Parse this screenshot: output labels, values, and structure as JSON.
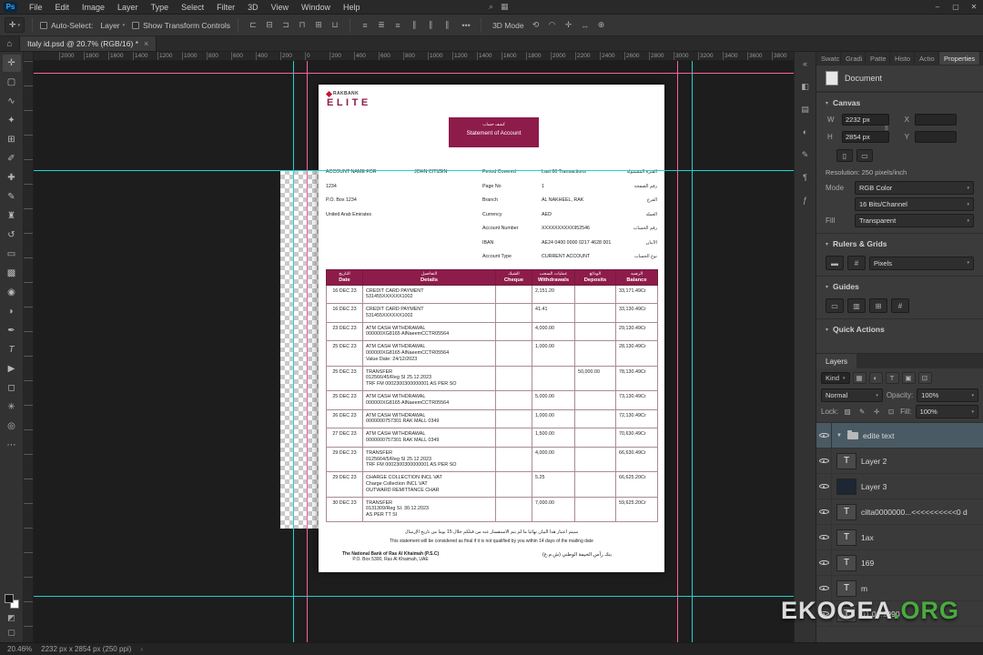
{
  "window": {
    "controls": {
      "minimize": "–",
      "maximize": "▢",
      "close": "✕"
    }
  },
  "menubar": {
    "app_badge": "Ps",
    "items": [
      "File",
      "Edit",
      "Image",
      "Layer",
      "Type",
      "Select",
      "Filter",
      "3D",
      "View",
      "Window",
      "Help"
    ],
    "extra_icons": [
      {
        "name": "search-icon",
        "glyph": "⌕"
      },
      {
        "name": "workspace-switcher-icon",
        "glyph": "▦"
      }
    ]
  },
  "options_bar": {
    "auto_select_label": "Auto-Select:",
    "auto_select_value": "Layer",
    "transform_label": "Show Transform Controls",
    "overflow": "•••",
    "mode_label": "3D Mode",
    "align_icons": [
      {
        "name": "align-left-edges-icon",
        "glyph": "⊏"
      },
      {
        "name": "align-horizontal-centers-icon",
        "glyph": "⊟"
      },
      {
        "name": "align-right-edges-icon",
        "glyph": "⊐"
      },
      {
        "name": "align-top-edges-icon",
        "glyph": "⊓"
      },
      {
        "name": "align-vertical-centers-icon",
        "glyph": "⊞"
      },
      {
        "name": "align-bottom-edges-icon",
        "glyph": "⊔"
      }
    ],
    "distribute_icons": [
      {
        "name": "distribute-top-edges-icon",
        "glyph": "≡"
      },
      {
        "name": "distribute-vertical-centers-icon",
        "glyph": "≣"
      },
      {
        "name": "distribute-bottom-edges-icon",
        "glyph": "≡"
      },
      {
        "name": "distribute-left-edges-icon",
        "glyph": "∥"
      },
      {
        "name": "distribute-horizontal-centers-icon",
        "glyph": "∥"
      },
      {
        "name": "distribute-right-edges-icon",
        "glyph": "∥"
      }
    ],
    "mode_icons": [
      {
        "name": "3d-rotate-icon",
        "glyph": "⟲"
      },
      {
        "name": "3d-roll-icon",
        "glyph": "◠"
      },
      {
        "name": "3d-pan-icon",
        "glyph": "✛"
      },
      {
        "name": "3d-slide-icon",
        "glyph": "↔"
      },
      {
        "name": "3d-scale-icon",
        "glyph": "⊕"
      }
    ]
  },
  "tab_bar": {
    "home_icon": "⌂",
    "title": "Italy id.psd @ 20.7% (RGB/16) *",
    "close": "×"
  },
  "ruler_labels": [
    "2000",
    "1800",
    "1600",
    "1400",
    "1200",
    "1000",
    "800",
    "600",
    "400",
    "200",
    "0",
    "200",
    "400",
    "600",
    "800",
    "1000",
    "1200",
    "1400",
    "1600",
    "1800",
    "2000",
    "2200",
    "2400",
    "2600",
    "2800",
    "3000",
    "3200",
    "3400",
    "3600",
    "3800",
    "4000"
  ],
  "tools": [
    {
      "name": "move-tool-icon",
      "glyph": "✛",
      "state": "active"
    },
    {
      "name": "rectangular-marquee-tool-icon",
      "glyph": "▢"
    },
    {
      "name": "lasso-tool-icon",
      "glyph": "∿"
    },
    {
      "name": "quick-selection-tool-icon",
      "glyph": "✦"
    },
    {
      "name": "crop-tool-icon",
      "glyph": "⊞"
    },
    {
      "name": "eyedropper-tool-icon",
      "glyph": "✐"
    },
    {
      "name": "healing-brush-tool-icon",
      "glyph": "✚"
    },
    {
      "name": "brush-tool-icon",
      "glyph": "✎"
    },
    {
      "name": "clone-stamp-tool-icon",
      "glyph": "♜"
    },
    {
      "name": "history-brush-tool-icon",
      "glyph": "↺"
    },
    {
      "name": "eraser-tool-icon",
      "glyph": "▭"
    },
    {
      "name": "gradient-tool-icon",
      "glyph": "▩"
    },
    {
      "name": "blur-tool-icon",
      "glyph": "◉"
    },
    {
      "name": "dodge-tool-icon",
      "glyph": "◗"
    },
    {
      "name": "pen-tool-icon",
      "glyph": "✒"
    },
    {
      "name": "type-tool-icon",
      "glyph": "T"
    },
    {
      "name": "path-selection-tool-icon",
      "glyph": "▶"
    },
    {
      "name": "shape-tool-icon",
      "glyph": "◻"
    },
    {
      "name": "hand-tool-icon",
      "glyph": "✳"
    },
    {
      "name": "zoom-tool-icon",
      "glyph": "◎"
    },
    {
      "name": "edit-toolbar-icon",
      "glyph": "⋯"
    }
  ],
  "panel_strip": [
    {
      "name": "collapse-panels-icon",
      "glyph": "«"
    },
    {
      "name": "color-panel-icon",
      "glyph": "◧"
    },
    {
      "name": "libraries-panel-icon",
      "glyph": "▤"
    },
    {
      "name": "adjustments-panel-icon",
      "glyph": "◐"
    },
    {
      "name": "brush-settings-panel-icon",
      "glyph": "✎"
    },
    {
      "name": "paragraph-panel-icon",
      "glyph": "¶"
    },
    {
      "name": "glyphs-panel-icon",
      "glyph": "ƒ"
    }
  ],
  "panel_tabs": [
    {
      "label": "Swatc"
    },
    {
      "label": "Gradi"
    },
    {
      "label": "Patte"
    },
    {
      "label": "Histo"
    },
    {
      "label": "Actio"
    },
    {
      "label": "Properties",
      "state": "active"
    }
  ],
  "properties": {
    "context": "Document",
    "canvas_section": "Canvas",
    "w_label": "W",
    "w_value": "2232 px",
    "x_label": "X",
    "x_value": "",
    "h_label": "H",
    "h_value": "2854 px",
    "y_label": "Y",
    "y_value": "",
    "resolution": "Resolution: 250 pixels/inch",
    "mode_label": "Mode",
    "mode_value": "RGB Color",
    "depth_value": "16 Bits/Channel",
    "fill_label": "Fill",
    "fill_value": "Transparent",
    "rulers_section": "Rulers & Grids",
    "rulers_unit": "Pixels",
    "rulers_icons": [
      {
        "name": "toggle-rulers-icon",
        "glyph": "▬"
      },
      {
        "name": "toggle-grid-icon",
        "glyph": "#"
      }
    ],
    "guides_section": "Guides",
    "guides_icons": [
      {
        "name": "new-guide-layout-icon",
        "glyph": "▭"
      },
      {
        "name": "guides-visibility-icon",
        "glyph": "▥"
      },
      {
        "name": "add-guides-icon",
        "glyph": "⊞"
      },
      {
        "name": "clear-guides-icon",
        "glyph": "#"
      }
    ],
    "quick_actions_section": "Quick Actions"
  },
  "layers_panel": {
    "tab": "Layers",
    "kind_label": "Kind",
    "filter_icons": [
      {
        "name": "pixel-layer-filter-icon",
        "glyph": "▦"
      },
      {
        "name": "adjustment-layer-filter-icon",
        "glyph": "◐"
      },
      {
        "name": "type-layer-filter-icon",
        "glyph": "T"
      },
      {
        "name": "shape-layer-filter-icon",
        "glyph": "▣"
      },
      {
        "name": "smart-object-filter-icon",
        "glyph": "⊡"
      }
    ],
    "blend_mode": "Normal",
    "opacity_label": "Opacity:",
    "opacity_value": "100%",
    "lock_label": "Lock:",
    "lock_icons": [
      {
        "name": "lock-transparency-icon",
        "glyph": "▨"
      },
      {
        "name": "lock-pixels-icon",
        "glyph": "✎"
      },
      {
        "name": "lock-position-icon",
        "glyph": "✛"
      },
      {
        "name": "lock-all-icon",
        "glyph": "⊡"
      }
    ],
    "fill_label": "Fill:",
    "fill_value": "100%",
    "rows": [
      {
        "label": "edite text",
        "glyph": "",
        "state": "group selected"
      },
      {
        "label": "Layer 2",
        "glyph": "T",
        "state": "text"
      },
      {
        "label": "Layer 3",
        "glyph": "",
        "state": "image"
      },
      {
        "label": "cilta0000000...<<<<<<<<<<0 d",
        "glyph": "T",
        "state": "text"
      },
      {
        "label": "1ax",
        "glyph": "T",
        "state": "text"
      },
      {
        "label": "169",
        "glyph": "T",
        "state": "text"
      },
      {
        "label": "m",
        "glyph": "T",
        "state": "text"
      },
      {
        "label": "01.01.1990",
        "glyph": "T",
        "state": "text"
      }
    ]
  },
  "status_bar": {
    "zoom": "20.46%",
    "info": "2232 px x 2854 px (250 ppi)",
    "chevron": "›"
  },
  "watermark": {
    "main": "EKOGEA",
    "suffix": ".ORG"
  },
  "doc": {
    "brand": {
      "wordmark": "RAKBANK",
      "elite": "ELITE"
    },
    "header": {
      "ar": "كشف حساب",
      "en": "Statement of Account"
    },
    "info_left": [
      {
        "label": "ACCOUNT NAME FOR",
        "value": "JOHN CITIZEN"
      },
      {
        "label": "1234",
        "value": ""
      },
      {
        "label": "P.O. Box 1234",
        "value": ""
      },
      {
        "label": "United Arab Emirates",
        "value": ""
      }
    ],
    "info_right": [
      {
        "label": "Period Covered",
        "value": "Last 60 Transactions",
        "ar": "الفترة المشمولة"
      },
      {
        "label": "Page No",
        "value": "1",
        "ar": "رقم الصفحة"
      },
      {
        "label": "Branch",
        "value": "AL NAKHEEL, RAK",
        "ar": "الفرع"
      },
      {
        "label": "Currency",
        "value": "AED",
        "ar": "العملة"
      },
      {
        "label": "Account Number",
        "value": "XXXXXXXXXX952546",
        "ar": "رقم الحساب"
      },
      {
        "label": "IBAN",
        "value": "AE24 0400 0000 0217 4628 001",
        "ar": "الآيبان"
      },
      {
        "label": "Account Type",
        "value": "CURRENT ACCOUNT",
        "ar": "نوع الحساب"
      }
    ],
    "table": {
      "headers": [
        {
          "ar": "التاريخ",
          "en": "Date"
        },
        {
          "ar": "التفاصيل",
          "en": "Details"
        },
        {
          "ar": "الشيك",
          "en": "Cheque"
        },
        {
          "ar": "عمليات السحب",
          "en": "Withdrawals"
        },
        {
          "ar": "الودائع",
          "en": "Deposits"
        },
        {
          "ar": "الرصيد",
          "en": "Balance"
        }
      ],
      "rows": [
        {
          "date": "16 DEC 23",
          "details": "CREDIT CARD PAYMENT\n531455XXXXXX1002",
          "cheque": "",
          "withdrawals": "2,151.20",
          "deposits": "",
          "balance": "33,171.49Cr"
        },
        {
          "date": "16 DEC 23",
          "details": "CREDIT CARD PAYMENT\n531455XXXXXX1002",
          "cheque": "",
          "withdrawals": "41.41",
          "deposits": "",
          "balance": "33,130.49Cr"
        },
        {
          "date": "23 DEC 23",
          "details": "ATM CASH WITHDRAWAL\n000000XG8165 AlNaeemCCTR05564",
          "cheque": "",
          "withdrawals": "4,000.00",
          "deposits": "",
          "balance": "29,130.49Cr"
        },
        {
          "date": "25 DEC 23",
          "details": "ATM CASH WITHDRAWAL\n000000XG8165 AlNaeemCCTR05564\nValue Date: 24/12/2023",
          "cheque": "",
          "withdrawals": "1,000.00",
          "deposits": "",
          "balance": "28,130.49Cr"
        },
        {
          "date": "25 DEC 23",
          "details": "TRANSFER\n012566/45/Reg SI 25.12.2023\nTRF FM 0002300300000001 AS PER SO",
          "cheque": "",
          "withdrawals": "",
          "deposits": "50,000.00",
          "balance": "78,130.49Cr"
        },
        {
          "date": "25 DEC 23",
          "details": "ATM CASH WITHDRAWAL\n000000XG8165 AlNaeemCCTR05564",
          "cheque": "",
          "withdrawals": "5,000.00",
          "deposits": "",
          "balance": "73,130.49Cr"
        },
        {
          "date": "26 DEC 23",
          "details": "ATM CASH WITHDRAWAL\n0000000757301 RAK MALL 0349",
          "cheque": "",
          "withdrawals": "1,000.00",
          "deposits": "",
          "balance": "72,130.49Cr"
        },
        {
          "date": "27 DEC 23",
          "details": "ATM CASH WITHDRAWAL\n0000000757301 RAK MALL 0349",
          "cheque": "",
          "withdrawals": "1,500.00",
          "deposits": "",
          "balance": "70,630.49Cr"
        },
        {
          "date": "29 DEC 23",
          "details": "TRANSFER\n0125664/5/Reg SI 25.12.2023\nTRF FM 0002300300000001 AS PER SO",
          "cheque": "",
          "withdrawals": "4,000.00",
          "deposits": "",
          "balance": "66,630.49Cr"
        },
        {
          "date": "29 DEC 23",
          "details": "CHARGE COLLECTION INCL VAT\nCharge Collection INCL VAT\nOUTWARD REMITTANCE CHAR",
          "cheque": "",
          "withdrawals": "5.25",
          "deposits": "",
          "balance": "66,625.20Cr"
        },
        {
          "date": "30 DEC 23",
          "details": "TRANSFER\n0131309/Reg SI. 30.12.2023\nAS PER TT SI",
          "cheque": "",
          "withdrawals": "7,000.00",
          "deposits": "",
          "balance": "59,625.20Cr"
        }
      ]
    },
    "notice_ar": "سيتم اعتبار هذا البيان نهائيا ما لم يتم الاستفسار عنه من قبلكم خلال 15 يوما من تاريخ الإرسال",
    "notice_en": "This statement will be considered as final if it is not qualified by you within 14 days of the mailing date",
    "bank_en_1": "The National Bank of Ras Al Khaimah (P.S.C)",
    "bank_en_2": "P.O. Box 5300, Ras Al Khaimah, UAE",
    "bank_ar": "بنك رأس الخيمة الوطني (ش.م.ع)"
  },
  "colors": {
    "maroon": "#8e1c4a",
    "logo_red": "#c8102e",
    "guide_cyan": "#1fd2d2",
    "guide_pink": "#ff5fa2",
    "watermark_green": "#4aaa3f"
  }
}
